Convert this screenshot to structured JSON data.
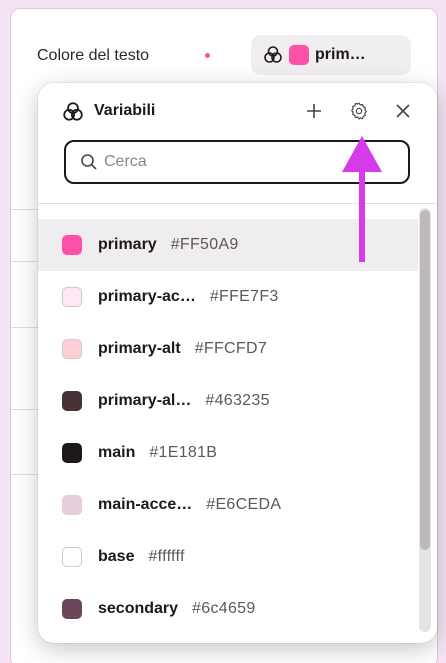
{
  "property": {
    "label": "Colore del testo",
    "chip_label": "prim…",
    "chip_color": "#FF50A9"
  },
  "popover": {
    "title": "Variabili",
    "title_icon": "color-variables-icon",
    "add_icon": "plus-icon",
    "settings_icon": "gear-icon",
    "close_icon": "close-icon",
    "search": {
      "placeholder": "Cerca",
      "value": "",
      "icon": "search-icon"
    },
    "items": [
      {
        "name": "primary",
        "hex": "#FF50A9",
        "color": "#FF50A9",
        "selected": true
      },
      {
        "name": "primary-ac…",
        "hex": "#FFE7F3",
        "color": "#FFE7F3",
        "selected": false
      },
      {
        "name": "primary-alt",
        "hex": "#FFCFD7",
        "color": "#FFCFD7",
        "selected": false
      },
      {
        "name": "primary-al…",
        "hex": "#463235",
        "color": "#463235",
        "selected": false
      },
      {
        "name": "main",
        "hex": "#1E181B",
        "color": "#1E181B",
        "selected": false
      },
      {
        "name": "main-acce…",
        "hex": "#E6CEDA",
        "color": "#E6CEDA",
        "selected": false
      },
      {
        "name": "base",
        "hex": "#ffffff",
        "color": "#ffffff",
        "selected": false
      },
      {
        "name": "secondary",
        "hex": "#6c4659",
        "color": "#6c4659",
        "selected": false
      }
    ]
  },
  "annotation_color": "#D63BEA"
}
